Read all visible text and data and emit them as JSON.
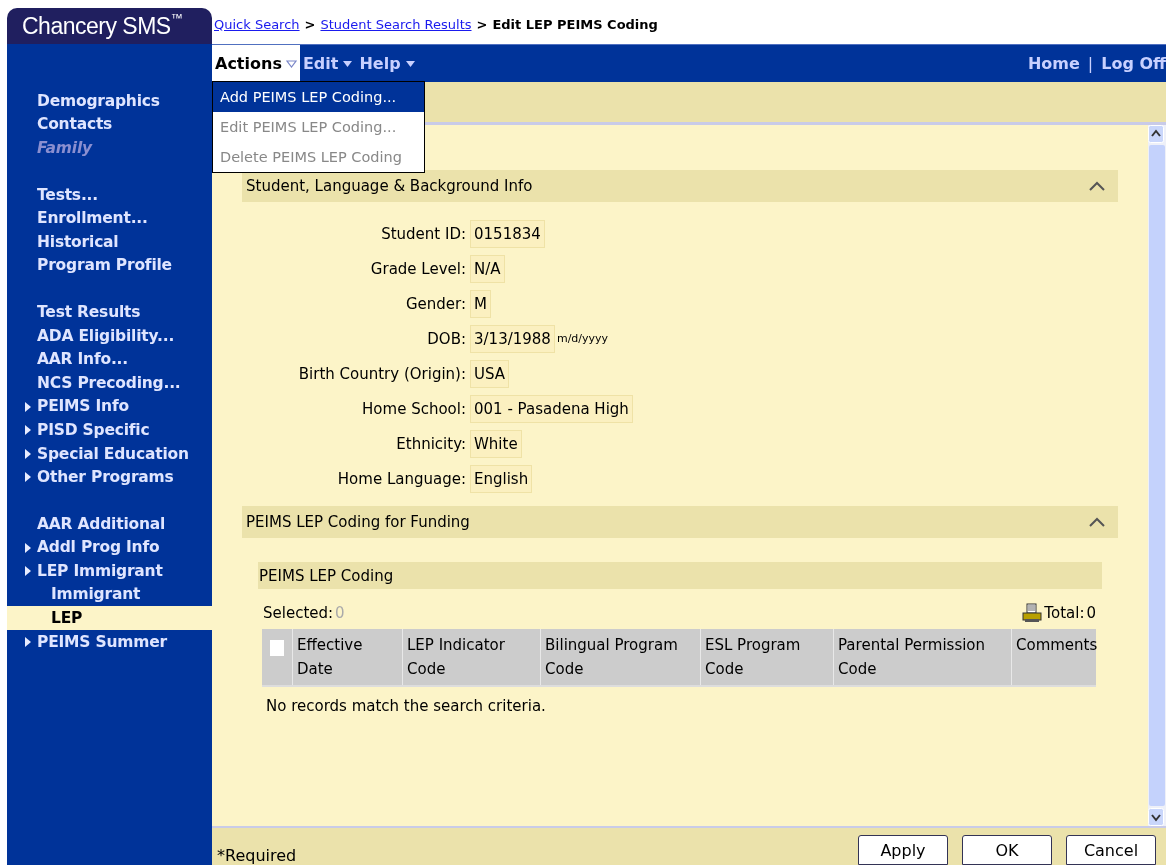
{
  "app": {
    "logo": "Chancery SMS",
    "logo_mark": "™"
  },
  "breadcrumb": {
    "separator": ">",
    "items": [
      {
        "label": "Quick Search",
        "link": true
      },
      {
        "label": "Student Search Results",
        "link": true
      },
      {
        "label": "Edit LEP PEIMS Coding",
        "link": false
      }
    ]
  },
  "menu": [
    {
      "label": "Actions",
      "open": true
    },
    {
      "label": "Edit",
      "open": false
    },
    {
      "label": "Help",
      "open": false
    }
  ],
  "dropdown": [
    {
      "label": "Add PEIMS LEP Coding...",
      "disabled": false,
      "selected": true
    },
    {
      "label": "Edit PEIMS LEP Coding...",
      "disabled": true,
      "selected": false
    },
    {
      "label": "Delete PEIMS LEP Coding",
      "disabled": true,
      "selected": false
    }
  ],
  "top_links": {
    "separator": "|",
    "items": [
      "Home",
      "Log Off"
    ]
  },
  "sidebar": {
    "groups": [
      [
        {
          "label": "Demographics",
          "kind": "link",
          "disabled": false,
          "selected": false
        },
        {
          "label": "Contacts",
          "kind": "link",
          "disabled": false,
          "selected": false
        },
        {
          "label": "Family",
          "kind": "link",
          "disabled": true,
          "selected": false
        }
      ],
      [
        {
          "label": "Tests...",
          "kind": "link",
          "disabled": false,
          "selected": false
        },
        {
          "label": "Enrollment...",
          "kind": "link",
          "disabled": false,
          "selected": false
        },
        {
          "label": "Historical",
          "kind": "link",
          "disabled": false,
          "selected": false
        },
        {
          "label": "Program Profile",
          "kind": "link",
          "disabled": false,
          "selected": false
        }
      ],
      [
        {
          "label": "Test Results",
          "kind": "link",
          "disabled": false,
          "selected": false
        },
        {
          "label": "ADA Eligibility...",
          "kind": "link",
          "disabled": false,
          "selected": false
        },
        {
          "label": "AAR Info...",
          "kind": "link",
          "disabled": false,
          "selected": false
        },
        {
          "label": "NCS Precoding...",
          "kind": "link",
          "disabled": false,
          "selected": false
        },
        {
          "label": "PEIMS Info",
          "kind": "folder",
          "disabled": false,
          "selected": false
        },
        {
          "label": "PISD Specific",
          "kind": "folder",
          "disabled": false,
          "selected": false
        },
        {
          "label": "Special Education",
          "kind": "folder",
          "disabled": false,
          "selected": false
        },
        {
          "label": "Other Programs",
          "kind": "folder",
          "disabled": false,
          "selected": false
        }
      ],
      [
        {
          "label": "AAR Additional",
          "kind": "link",
          "disabled": false,
          "selected": false
        },
        {
          "label": "Addl Prog Info",
          "kind": "folder",
          "disabled": false,
          "selected": false
        },
        {
          "label": "LEP Immigrant",
          "kind": "folder",
          "disabled": false,
          "selected": false,
          "children": [
            {
              "label": "Immigrant",
              "kind": "link",
              "disabled": false,
              "selected": false
            },
            {
              "label": "LEP",
              "kind": "link",
              "disabled": false,
              "selected": true
            }
          ]
        },
        {
          "label": "PEIMS Summer",
          "kind": "folder",
          "disabled": false,
          "selected": false
        }
      ]
    ]
  },
  "info_section": {
    "title": "Student, Language & Background Info",
    "expanded": true,
    "fields": [
      {
        "label": "Student ID:",
        "value": "0151834"
      },
      {
        "label": "Grade Level:",
        "value": "N/A"
      },
      {
        "label": "Gender:",
        "value": "M"
      },
      {
        "label": "DOB:",
        "value": "3/13/1988",
        "hint": "m/d/yyyy"
      },
      {
        "label": "Birth Country (Origin):",
        "value": "USA"
      },
      {
        "label": "Home School:",
        "value": "001 - Pasadena High"
      },
      {
        "label": "Ethnicity:",
        "value": "White"
      },
      {
        "label": "Home Language:",
        "value": "English"
      }
    ]
  },
  "coding_section": {
    "title": "PEIMS LEP Coding for Funding",
    "expanded": true,
    "subtitle": "PEIMS LEP Coding",
    "selected_label": "Selected:",
    "selected_count": "0",
    "total_label": "Total:",
    "total_count": "0",
    "table": {
      "select_all_checked": false,
      "columns": [
        "Effective Date",
        "LEP Indicator Code",
        "Bilingual Program Code",
        "ESL Program Code",
        "Parental Permission Code",
        "Comments"
      ],
      "empty_message": "No records match the search criteria."
    }
  },
  "footer": {
    "note": "*Required",
    "buttons": [
      "Apply",
      "OK",
      "Cancel"
    ]
  }
}
